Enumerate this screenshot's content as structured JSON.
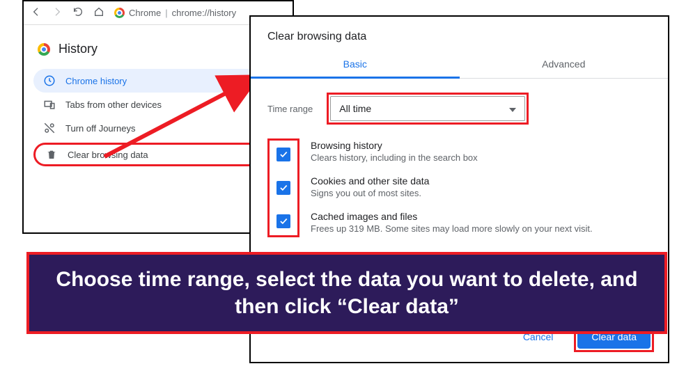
{
  "history_window": {
    "address_prefix": "Chrome",
    "address_path": "chrome://history",
    "title": "History",
    "menu": [
      {
        "label": "Chrome history",
        "icon": "clock-icon",
        "active": true
      },
      {
        "label": "Tabs from other devices",
        "icon": "devices-icon",
        "active": false
      },
      {
        "label": "Turn off Journeys",
        "icon": "journeys-off-icon",
        "active": false
      },
      {
        "label": "Clear browsing data",
        "icon": "trash-icon",
        "active": false,
        "external": true,
        "highlighted": true
      }
    ]
  },
  "dialog": {
    "title": "Clear browsing data",
    "tabs": {
      "basic": "Basic",
      "advanced": "Advanced",
      "active": "basic"
    },
    "time_range_label": "Time range",
    "time_range_value": "All time",
    "options": [
      {
        "title": "Browsing history",
        "desc": "Clears history, including in the search box",
        "checked": true
      },
      {
        "title": "Cookies and other site data",
        "desc": "Signs you out of most sites.",
        "checked": true
      },
      {
        "title": "Cached images and files",
        "desc": "Frees up 319 MB. Some sites may load more slowly on your next visit.",
        "checked": true
      }
    ],
    "cancel_label": "Cancel",
    "clear_label": "Clear data"
  },
  "annotation": {
    "text": "Choose time range, select the data you want to delete, and then click “Clear data”"
  }
}
